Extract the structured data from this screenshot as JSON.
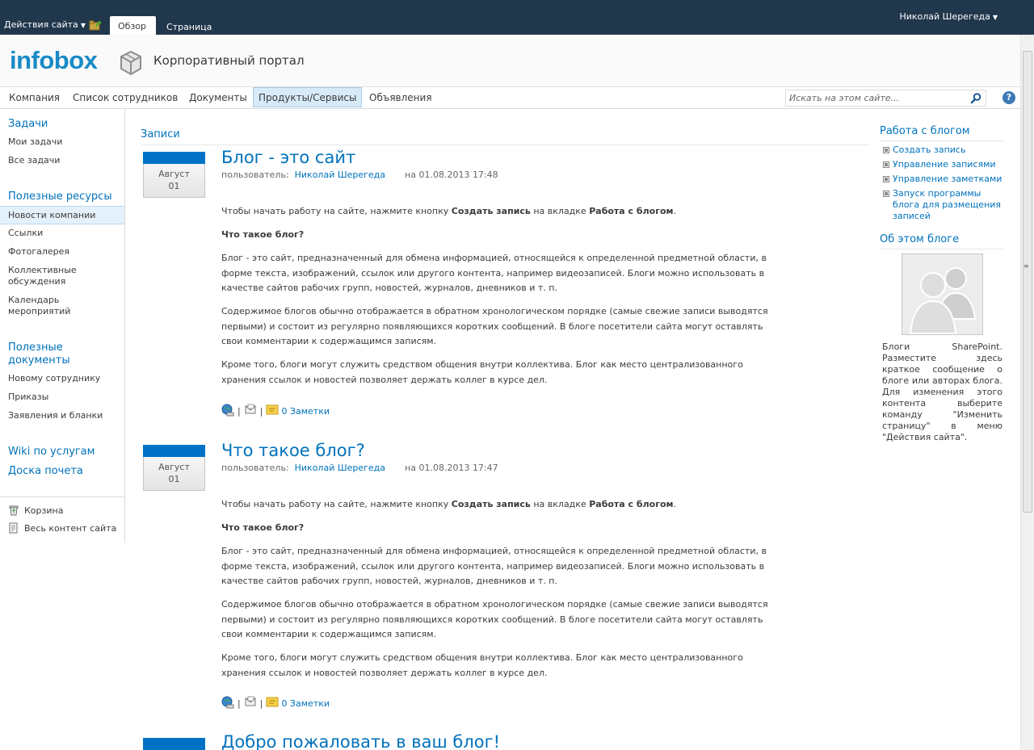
{
  "ribbon": {
    "site_actions": "Действия сайта",
    "tabs": [
      {
        "label": "Обзор"
      },
      {
        "label": "Страница"
      }
    ],
    "user_name": "Николай Шерегеда"
  },
  "header": {
    "logo_text": "infobox",
    "site_title": "Корпоративный портал"
  },
  "top_nav": {
    "items": [
      {
        "label": "Компания"
      },
      {
        "label": "Список сотрудников"
      },
      {
        "label": "Документы"
      },
      {
        "label": "Продукты/Сервисы",
        "selected": true
      },
      {
        "label": "Объявления"
      }
    ],
    "search_placeholder": "Искать на этом сайте..."
  },
  "left_nav": {
    "groups": [
      {
        "heading": "Задачи",
        "items": [
          "Мои задачи",
          "Все задачи"
        ]
      },
      {
        "heading": "Полезные ресурсы",
        "items": [
          "Новости компании",
          "Ссылки",
          "Фотогалерея",
          "Коллективные обсуждения",
          "Календарь мероприятий"
        ]
      },
      {
        "heading": "Полезные документы",
        "items": [
          "Новому сотруднику",
          "Приказы",
          "Заявления и бланки"
        ]
      },
      {
        "heading": "Wiki по услугам",
        "items": []
      },
      {
        "heading": "Доска почета",
        "items": []
      }
    ],
    "recycle_bin": "Корзина",
    "all_content": "Весь контент сайта"
  },
  "main": {
    "section_title": "Записи",
    "by_label": "пользователь:",
    "posts": [
      {
        "month": "Август",
        "day": "01",
        "title": "Блог - это сайт",
        "author": "Николай Шерегеда",
        "date": "на 01.08.2013 17:48",
        "comments": "0 Заметки"
      },
      {
        "month": "Август",
        "day": "01",
        "title": "Что такое блог?",
        "author": "Николай Шерегеда",
        "date": "на 01.08.2013 17:47",
        "comments": "0 Заметки"
      },
      {
        "month": "",
        "day": "",
        "title": "Добро пожаловать в ваш блог!",
        "author": "",
        "date": "",
        "comments": ""
      }
    ],
    "body": {
      "p1_a": "Чтобы начать работу на сайте, нажмите кнопку ",
      "p1_b": "Создать запись",
      "p1_c": " на вкладке ",
      "p1_d": "Работа с блогом",
      "p1_e": ".",
      "p2": "Что такое блог?",
      "p3": "Блог - это сайт, предназначенный для обмена информацией, относящейся к определенной предметной области, в форме текста, изображений, ссылок или другого контента, например видеозаписей. Блоги можно использовать в качестве сайтов рабочих групп, новостей, журналов, дневников и т. п.",
      "p4": "Содержимое блогов обычно отображается в обратном хронологическом порядке (самые свежие записи выводятся первыми) и состоит из регулярно появляющихся коротких сообщений. В блоге посетители сайта могут оставлять свои комментарии к содержащимся записям.",
      "p5": "Кроме того, блоги могут служить средством общения внутри коллектива. Блог как место централизованного хранения ссылок и новостей позволяет держать коллег в курсе дел."
    }
  },
  "right_col": {
    "tools_heading": "Работа с блогом",
    "tools": [
      "Создать запись",
      "Управление записями",
      "Управление заметками",
      "Запуск программы блога для размещения записей"
    ],
    "about_heading": "Об этом блоге",
    "about_text": "Блоги SharePoint. Разместите здесь краткое сообщение о блоге или авторах блога. Для изменения этого контента выберите команду \"Изменить страницу\" в меню \"Действия сайта\"."
  },
  "colors": {
    "accent": "#0072bc",
    "ribbon_bg": "#21374c",
    "date_band": "#0072c6",
    "selected_nav_bg": "#d7eaf8"
  }
}
